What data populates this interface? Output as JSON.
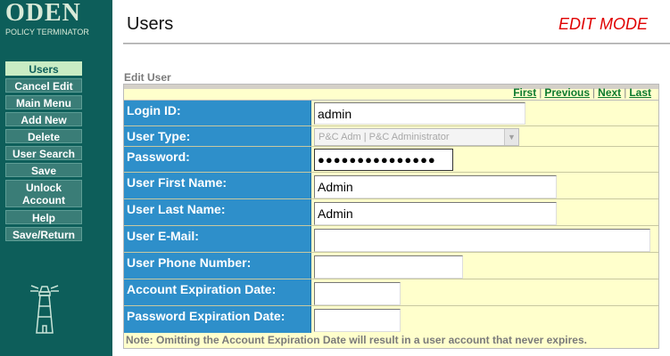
{
  "logo": {
    "title": "ODEN",
    "subtitle": "POLICY TERMINATOR"
  },
  "sidebar": {
    "items": [
      {
        "label": "Users",
        "active": true
      },
      {
        "label": "Cancel Edit"
      },
      {
        "label": "Main Menu"
      },
      {
        "label": "Add New"
      },
      {
        "label": "Delete"
      },
      {
        "label": "User Search"
      },
      {
        "label": "Save"
      },
      {
        "label": "Unlock Account"
      },
      {
        "label": "Help"
      },
      {
        "label": "Save/Return"
      }
    ],
    "logo_icon": "lighthouse-icon"
  },
  "header": {
    "title": "Users",
    "mode": "EDIT MODE"
  },
  "form": {
    "section_label": "Edit User",
    "nav": {
      "first": "First",
      "previous": "Previous",
      "next": "Next",
      "last": "Last"
    },
    "fields": {
      "login_id": {
        "label": "Login ID:",
        "value": "admin"
      },
      "user_type": {
        "label": "User Type:",
        "value": "P&C Adm | P&C Administrator"
      },
      "password": {
        "label": "Password:",
        "value": "●●●●●●●●●●●●●●●"
      },
      "first_name": {
        "label": "User First Name:",
        "value": "Admin"
      },
      "last_name": {
        "label": "User Last Name:",
        "value": "Admin"
      },
      "email": {
        "label": "User E-Mail:",
        "value": ""
      },
      "phone": {
        "label": "User Phone Number:",
        "value": ""
      },
      "account_expiration": {
        "label": "Account Expiration Date:",
        "value": ""
      },
      "password_expiration": {
        "label": "Password Expiration Date:",
        "value": ""
      }
    },
    "note": "Note: Omitting the Account Expiration Date will result in a user account that never expires."
  },
  "colors": {
    "sidebar": "#0d5e5a",
    "label_bg": "#2e8fca",
    "form_bg": "#ffffcc",
    "edit_mode": "#e00000",
    "nav_link": "#0d7a2e"
  }
}
